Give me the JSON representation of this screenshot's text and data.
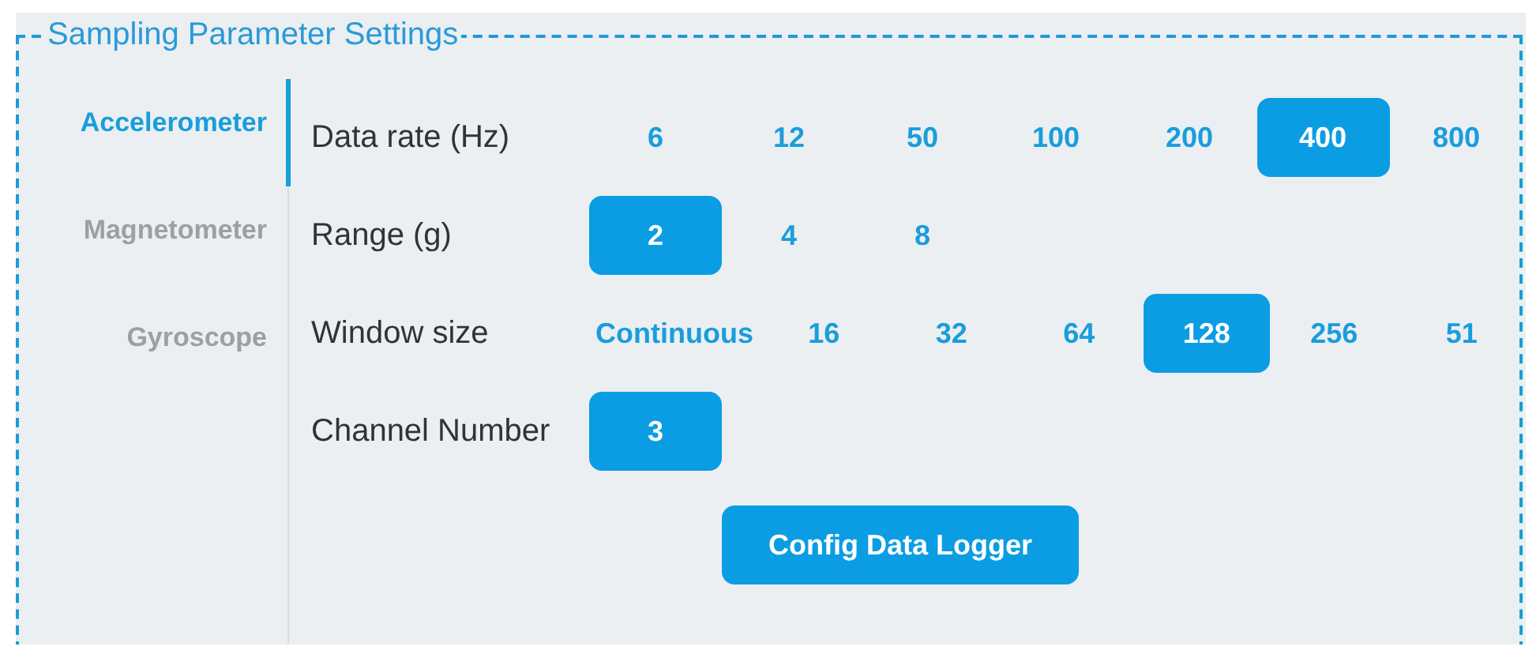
{
  "title": "Sampling Parameter Settings",
  "sensors": [
    {
      "label": "Accelerometer",
      "selected": true
    },
    {
      "label": "Magnetometer",
      "selected": false
    },
    {
      "label": "Gyroscope",
      "selected": false
    }
  ],
  "parameters": [
    {
      "label": "Data rate (Hz)",
      "options": [
        {
          "label": "6",
          "selected": false
        },
        {
          "label": "12",
          "selected": false
        },
        {
          "label": "50",
          "selected": false
        },
        {
          "label": "100",
          "selected": false
        },
        {
          "label": "200",
          "selected": false
        },
        {
          "label": "400",
          "selected": true
        },
        {
          "label": "800",
          "selected": false
        }
      ]
    },
    {
      "label": "Range (g)",
      "options": [
        {
          "label": "2",
          "selected": true
        },
        {
          "label": "4",
          "selected": false
        },
        {
          "label": "8",
          "selected": false
        }
      ]
    },
    {
      "label": "Window size",
      "options": [
        {
          "label": "Continuous",
          "selected": false
        },
        {
          "label": "16",
          "selected": false
        },
        {
          "label": "32",
          "selected": false
        },
        {
          "label": "64",
          "selected": false
        },
        {
          "label": "128",
          "selected": true
        },
        {
          "label": "256",
          "selected": false
        },
        {
          "label": "51",
          "selected": false
        }
      ]
    },
    {
      "label": "Channel Number",
      "options": [
        {
          "label": "3",
          "selected": true
        }
      ]
    }
  ],
  "action_button": "Config Data Logger"
}
